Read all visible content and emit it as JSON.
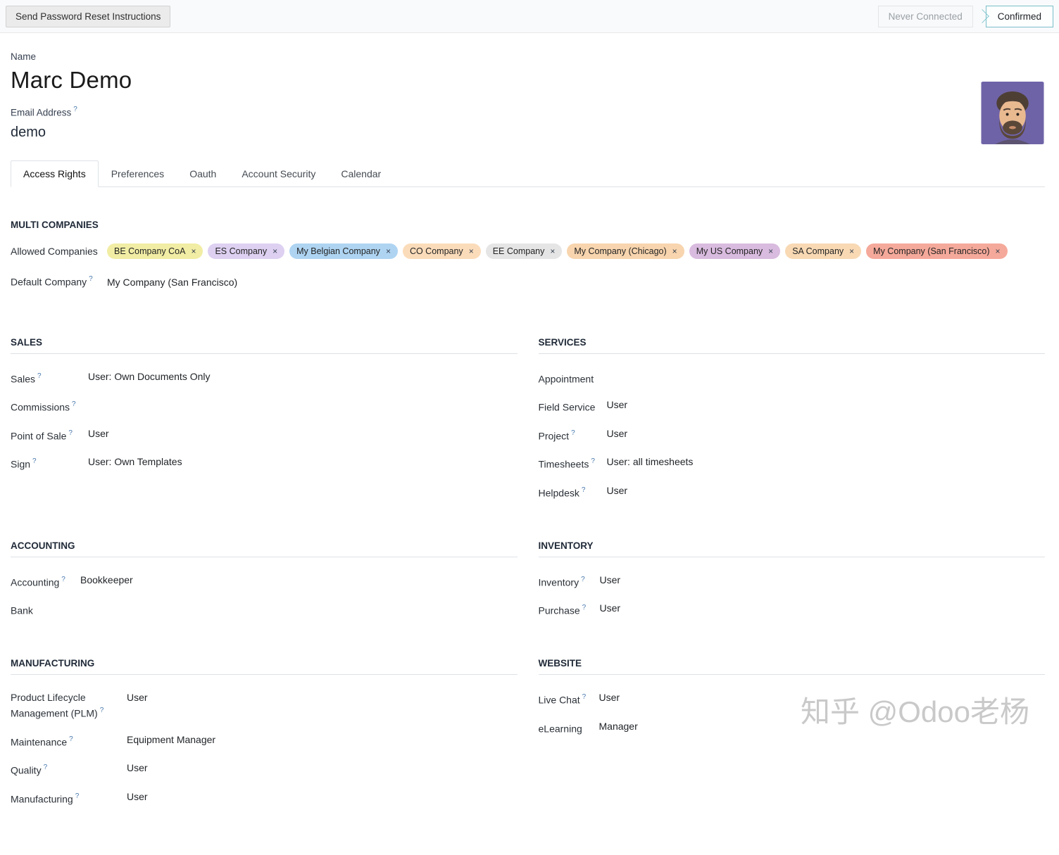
{
  "topbar": {
    "reset_button": "Send Password Reset Instructions",
    "statusbar": {
      "muted": "Never Connected",
      "active": "Confirmed"
    }
  },
  "profile": {
    "name_label": "Name",
    "name": "Marc Demo",
    "email_label": "Email Address",
    "email_help": "?",
    "email_value": "demo"
  },
  "tabs": [
    {
      "label": "Access Rights"
    },
    {
      "label": "Preferences"
    },
    {
      "label": "Oauth"
    },
    {
      "label": "Account Security"
    },
    {
      "label": "Calendar"
    }
  ],
  "multi_companies": {
    "title": "MULTI COMPANIES",
    "allowed_label": "Allowed Companies",
    "remove_icon": "×",
    "default_label": "Default Company",
    "default_help": "?",
    "default_value": "My Company (San Francisco)",
    "tags": [
      {
        "label": "BE Company CoA",
        "color": "#f1eda4"
      },
      {
        "label": "ES Company",
        "color": "#ddd0f1"
      },
      {
        "label": "My Belgian Company",
        "color": "#aed4f2"
      },
      {
        "label": "CO Company",
        "color": "#fbdcba"
      },
      {
        "label": "EE Company",
        "color": "#e5e5e5"
      },
      {
        "label": "My Company (Chicago)",
        "color": "#f8d5ae"
      },
      {
        "label": "My US Company",
        "color": "#d9bbdf"
      },
      {
        "label": "SA Company",
        "color": "#f8d9b4"
      },
      {
        "label": "My Company (San Francisco)",
        "color": "#f5a99a"
      }
    ]
  },
  "sections": {
    "sales": {
      "title": "SALES",
      "rows": [
        {
          "label": "Sales",
          "help": "?",
          "value": "User: Own Documents Only"
        },
        {
          "label": "Commissions",
          "help": "?",
          "value": ""
        },
        {
          "label": "Point of Sale",
          "help": "?",
          "value": "User"
        },
        {
          "label": "Sign",
          "help": "?",
          "value": "User: Own Templates"
        }
      ]
    },
    "services": {
      "title": "SERVICES",
      "rows": [
        {
          "label": "Appointment",
          "help": "",
          "value": ""
        },
        {
          "label": "Field Service",
          "help": "",
          "value": "User"
        },
        {
          "label": "Project",
          "help": "?",
          "value": "User"
        },
        {
          "label": "Timesheets",
          "help": "?",
          "value": "User: all timesheets"
        },
        {
          "label": "Helpdesk",
          "help": "?",
          "value": "User"
        }
      ]
    },
    "accounting": {
      "title": "ACCOUNTING",
      "rows": [
        {
          "label": "Accounting",
          "help": "?",
          "value": "Bookkeeper"
        },
        {
          "label": "Bank",
          "help": "",
          "value": ""
        }
      ]
    },
    "inventory": {
      "title": "INVENTORY",
      "rows": [
        {
          "label": "Inventory",
          "help": "?",
          "value": "User"
        },
        {
          "label": "Purchase",
          "help": "?",
          "value": "User"
        }
      ]
    },
    "manufacturing": {
      "title": "MANUFACTURING",
      "rows": [
        {
          "label": "Product Lifecycle Management (PLM)",
          "help": "?",
          "value": "User"
        },
        {
          "label": "Maintenance",
          "help": "?",
          "value": "Equipment Manager"
        },
        {
          "label": "Quality",
          "help": "?",
          "value": "User"
        },
        {
          "label": "Manufacturing",
          "help": "?",
          "value": "User"
        }
      ]
    },
    "website": {
      "title": "WEBSITE",
      "rows": [
        {
          "label": "Live Chat",
          "help": "?",
          "value": "User"
        },
        {
          "label": "eLearning",
          "help": "",
          "value": "Manager"
        }
      ]
    }
  },
  "watermark": "知乎 @Odoo老杨",
  "colors": {
    "status_accent": "#79bec9",
    "help_blue": "#4878ad",
    "avatar_bg": "#6f63a7",
    "tab_border": "#dee2e6"
  }
}
